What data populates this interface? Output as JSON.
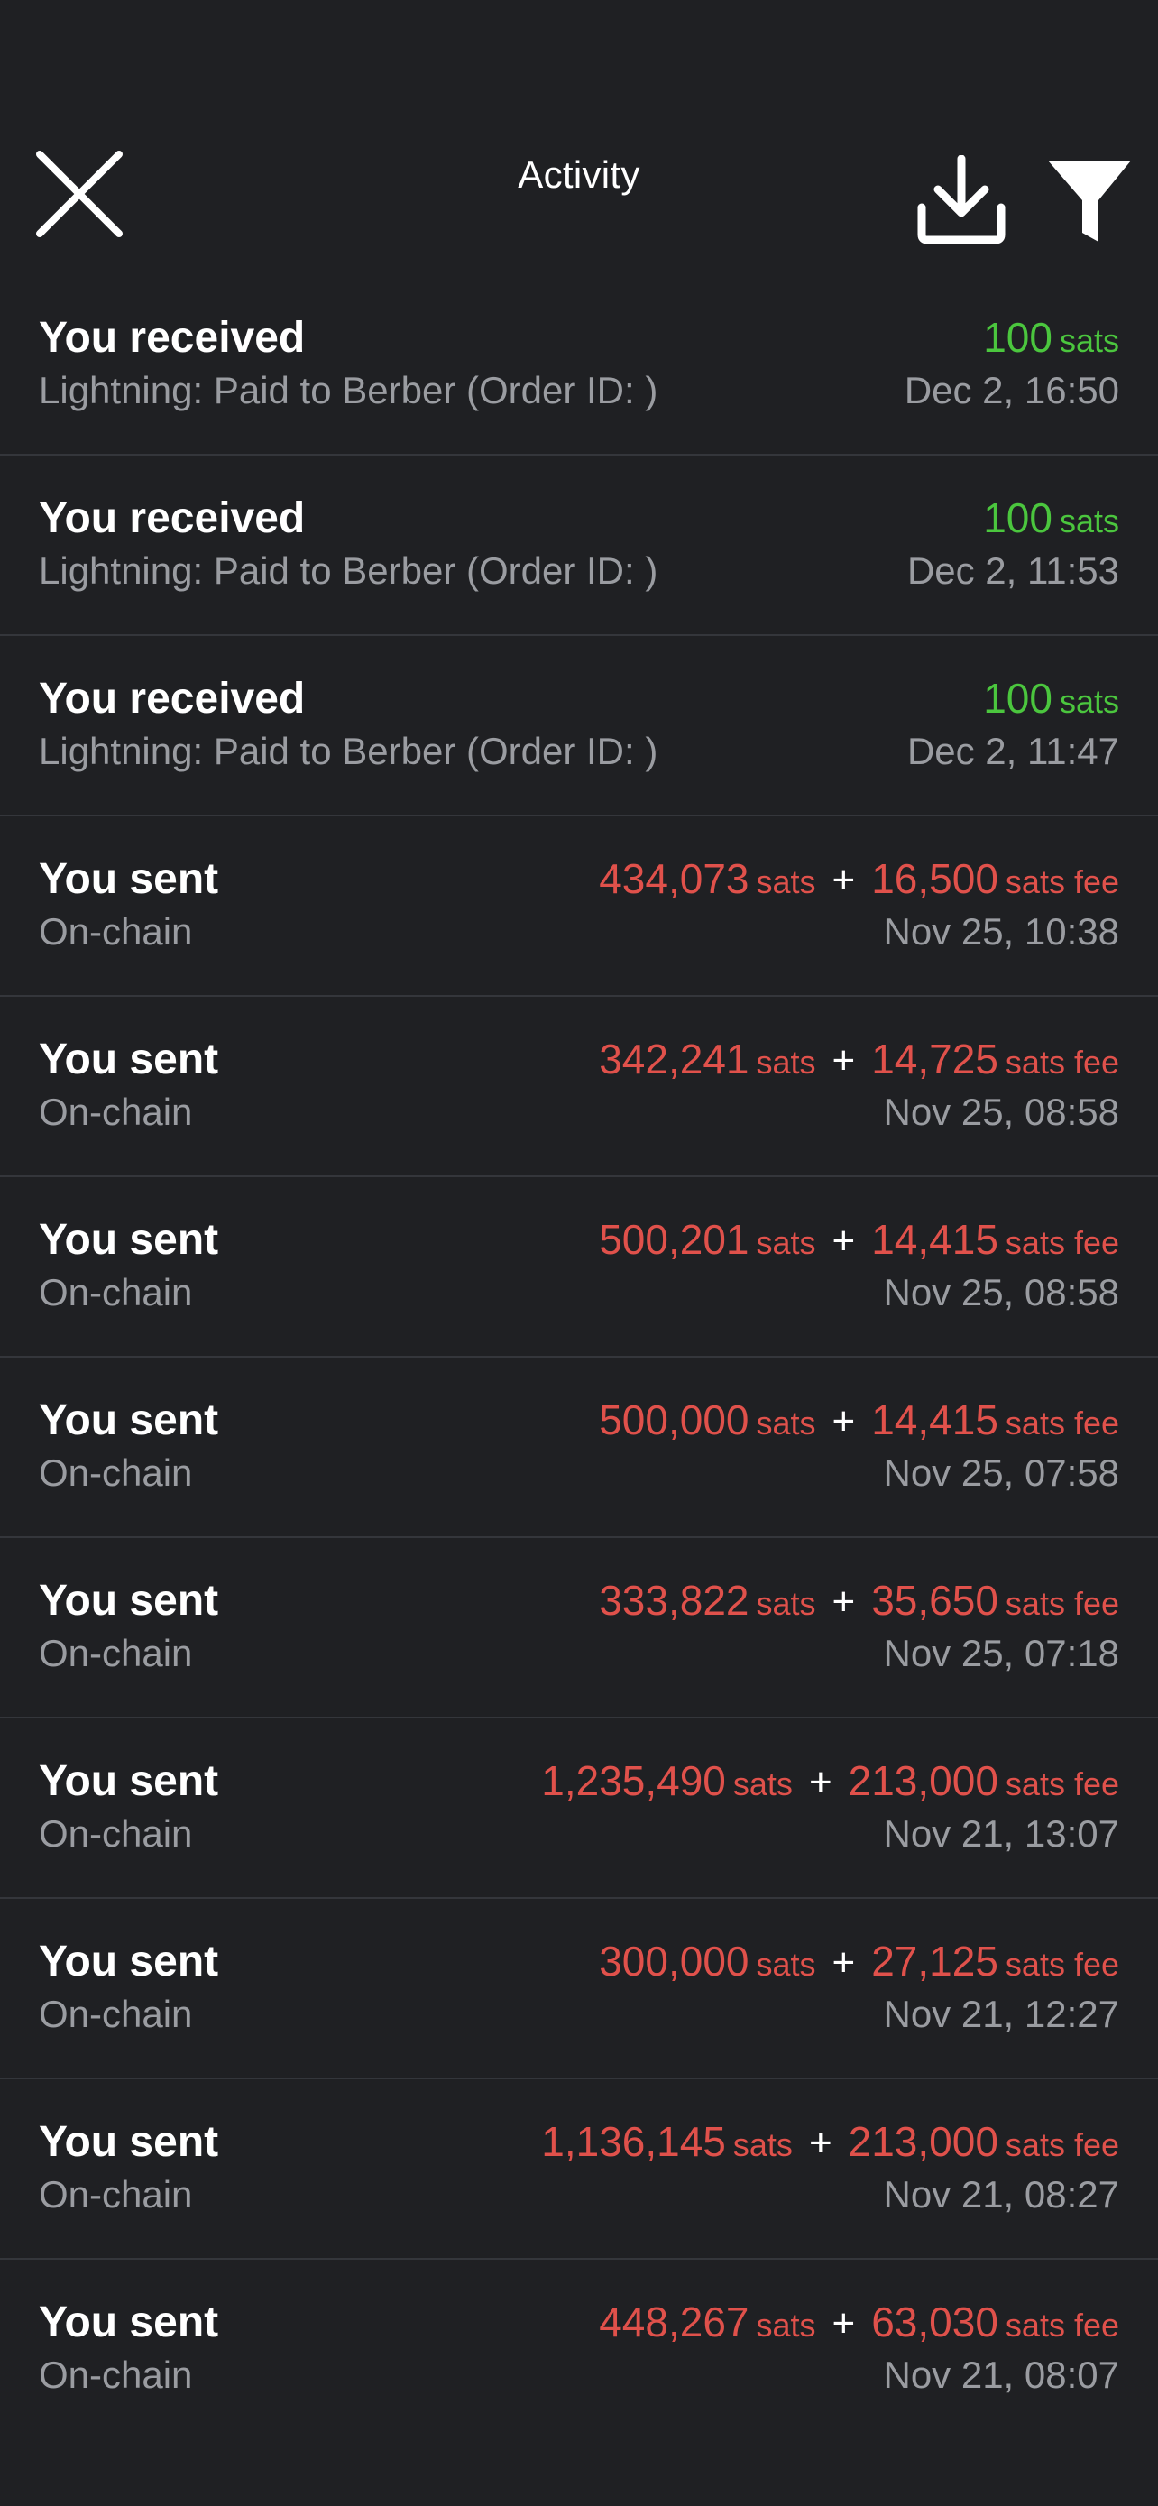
{
  "header": {
    "title": "Activity"
  },
  "colors": {
    "background": "#1f2023",
    "received": "#4bc63e",
    "sent": "#e0514b",
    "secondary_text": "#9a9ca1",
    "divider": "#34363b"
  },
  "transactions": [
    {
      "title": "You received",
      "subtitle": "Lightning: Paid to Berber (Order ID: )",
      "amount": "100",
      "unit": "sats",
      "date": "Dec 2, 16:50",
      "type": "received"
    },
    {
      "title": "You received",
      "subtitle": "Lightning: Paid to Berber (Order ID: )",
      "amount": "100",
      "unit": "sats",
      "date": "Dec 2, 11:53",
      "type": "received"
    },
    {
      "title": "You received",
      "subtitle": "Lightning: Paid to Berber (Order ID: )",
      "amount": "100",
      "unit": "sats",
      "date": "Dec 2, 11:47",
      "type": "received"
    },
    {
      "title": "You sent",
      "subtitle": "On-chain",
      "amount": "434,073",
      "unit": "sats",
      "plus": "+",
      "fee": "16,500",
      "fee_unit": "sats fee",
      "date": "Nov 25, 10:38",
      "type": "sent"
    },
    {
      "title": "You sent",
      "subtitle": "On-chain",
      "amount": "342,241",
      "unit": "sats",
      "plus": "+",
      "fee": "14,725",
      "fee_unit": "sats fee",
      "date": "Nov 25, 08:58",
      "type": "sent"
    },
    {
      "title": "You sent",
      "subtitle": "On-chain",
      "amount": "500,201",
      "unit": "sats",
      "plus": "+",
      "fee": "14,415",
      "fee_unit": "sats fee",
      "date": "Nov 25, 08:58",
      "type": "sent"
    },
    {
      "title": "You sent",
      "subtitle": "On-chain",
      "amount": "500,000",
      "unit": "sats",
      "plus": "+",
      "fee": "14,415",
      "fee_unit": "sats fee",
      "date": "Nov 25, 07:58",
      "type": "sent"
    },
    {
      "title": "You sent",
      "subtitle": "On-chain",
      "amount": "333,822",
      "unit": "sats",
      "plus": "+",
      "fee": "35,650",
      "fee_unit": "sats fee",
      "date": "Nov 25, 07:18",
      "type": "sent"
    },
    {
      "title": "You sent",
      "subtitle": "On-chain",
      "amount": "1,235,490",
      "unit": "sats",
      "plus": "+",
      "fee": "213,000",
      "fee_unit": "sats fee",
      "date": "Nov 21, 13:07",
      "type": "sent"
    },
    {
      "title": "You sent",
      "subtitle": "On-chain",
      "amount": "300,000",
      "unit": "sats",
      "plus": "+",
      "fee": "27,125",
      "fee_unit": "sats fee",
      "date": "Nov 21, 12:27",
      "type": "sent"
    },
    {
      "title": "You sent",
      "subtitle": "On-chain",
      "amount": "1,136,145",
      "unit": "sats",
      "plus": "+",
      "fee": "213,000",
      "fee_unit": "sats fee",
      "date": "Nov 21, 08:27",
      "type": "sent"
    },
    {
      "title": "You sent",
      "subtitle": "On-chain",
      "amount": "448,267",
      "unit": "sats",
      "plus": "+",
      "fee": "63,030",
      "fee_unit": "sats fee",
      "date": "Nov 21, 08:07",
      "type": "sent"
    }
  ]
}
